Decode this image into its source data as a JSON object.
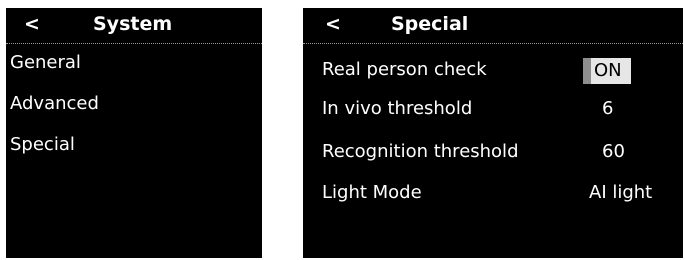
{
  "system_screen": {
    "back_label": "<",
    "title": "System",
    "items": [
      {
        "label": "General"
      },
      {
        "label": "Advanced"
      },
      {
        "label": "Special"
      }
    ]
  },
  "special_screen": {
    "back_label": "<",
    "title": "Special",
    "settings": [
      {
        "label": "Real person check",
        "value": "ON"
      },
      {
        "label": "In vivo threshold",
        "value": "6"
      },
      {
        "label": "Recognition threshold",
        "value": "60"
      },
      {
        "label": "Light Mode",
        "value": "AI light"
      }
    ]
  },
  "colors": {
    "screen_background": "#000000",
    "text": "#ffffff",
    "toggle_background": "#e6e6e6",
    "toggle_accent": "#8e8e8e"
  }
}
